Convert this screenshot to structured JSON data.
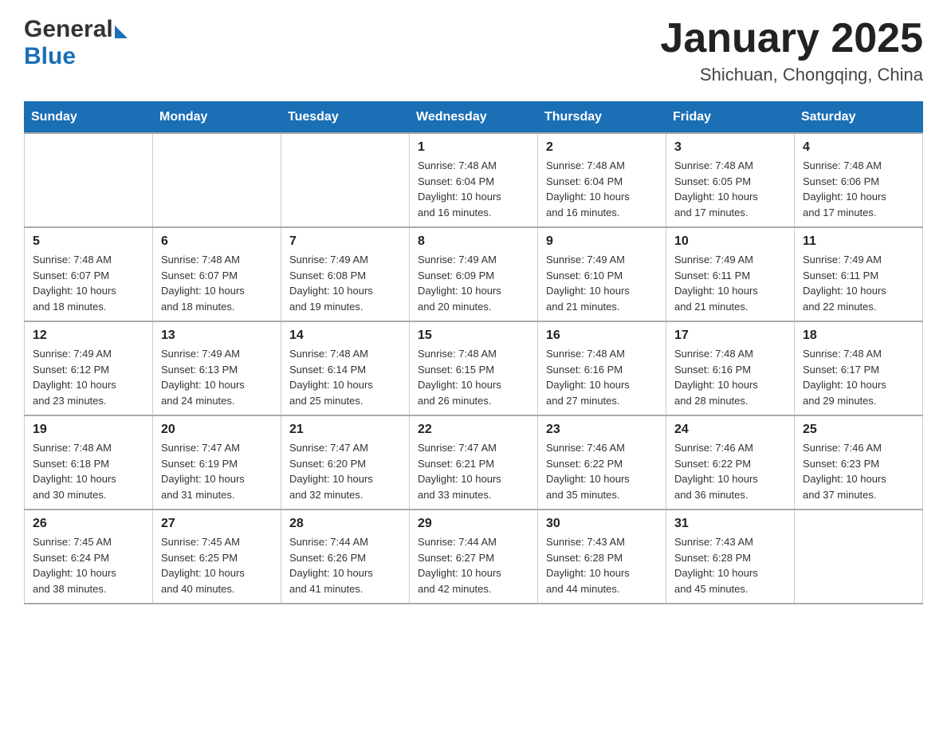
{
  "header": {
    "logo_general": "General",
    "logo_blue": "Blue",
    "month_title": "January 2025",
    "location": "Shichuan, Chongqing, China"
  },
  "weekdays": [
    "Sunday",
    "Monday",
    "Tuesday",
    "Wednesday",
    "Thursday",
    "Friday",
    "Saturday"
  ],
  "weeks": [
    [
      {
        "day": "",
        "info": ""
      },
      {
        "day": "",
        "info": ""
      },
      {
        "day": "",
        "info": ""
      },
      {
        "day": "1",
        "info": "Sunrise: 7:48 AM\nSunset: 6:04 PM\nDaylight: 10 hours\nand 16 minutes."
      },
      {
        "day": "2",
        "info": "Sunrise: 7:48 AM\nSunset: 6:04 PM\nDaylight: 10 hours\nand 16 minutes."
      },
      {
        "day": "3",
        "info": "Sunrise: 7:48 AM\nSunset: 6:05 PM\nDaylight: 10 hours\nand 17 minutes."
      },
      {
        "day": "4",
        "info": "Sunrise: 7:48 AM\nSunset: 6:06 PM\nDaylight: 10 hours\nand 17 minutes."
      }
    ],
    [
      {
        "day": "5",
        "info": "Sunrise: 7:48 AM\nSunset: 6:07 PM\nDaylight: 10 hours\nand 18 minutes."
      },
      {
        "day": "6",
        "info": "Sunrise: 7:48 AM\nSunset: 6:07 PM\nDaylight: 10 hours\nand 18 minutes."
      },
      {
        "day": "7",
        "info": "Sunrise: 7:49 AM\nSunset: 6:08 PM\nDaylight: 10 hours\nand 19 minutes."
      },
      {
        "day": "8",
        "info": "Sunrise: 7:49 AM\nSunset: 6:09 PM\nDaylight: 10 hours\nand 20 minutes."
      },
      {
        "day": "9",
        "info": "Sunrise: 7:49 AM\nSunset: 6:10 PM\nDaylight: 10 hours\nand 21 minutes."
      },
      {
        "day": "10",
        "info": "Sunrise: 7:49 AM\nSunset: 6:11 PM\nDaylight: 10 hours\nand 21 minutes."
      },
      {
        "day": "11",
        "info": "Sunrise: 7:49 AM\nSunset: 6:11 PM\nDaylight: 10 hours\nand 22 minutes."
      }
    ],
    [
      {
        "day": "12",
        "info": "Sunrise: 7:49 AM\nSunset: 6:12 PM\nDaylight: 10 hours\nand 23 minutes."
      },
      {
        "day": "13",
        "info": "Sunrise: 7:49 AM\nSunset: 6:13 PM\nDaylight: 10 hours\nand 24 minutes."
      },
      {
        "day": "14",
        "info": "Sunrise: 7:48 AM\nSunset: 6:14 PM\nDaylight: 10 hours\nand 25 minutes."
      },
      {
        "day": "15",
        "info": "Sunrise: 7:48 AM\nSunset: 6:15 PM\nDaylight: 10 hours\nand 26 minutes."
      },
      {
        "day": "16",
        "info": "Sunrise: 7:48 AM\nSunset: 6:16 PM\nDaylight: 10 hours\nand 27 minutes."
      },
      {
        "day": "17",
        "info": "Sunrise: 7:48 AM\nSunset: 6:16 PM\nDaylight: 10 hours\nand 28 minutes."
      },
      {
        "day": "18",
        "info": "Sunrise: 7:48 AM\nSunset: 6:17 PM\nDaylight: 10 hours\nand 29 minutes."
      }
    ],
    [
      {
        "day": "19",
        "info": "Sunrise: 7:48 AM\nSunset: 6:18 PM\nDaylight: 10 hours\nand 30 minutes."
      },
      {
        "day": "20",
        "info": "Sunrise: 7:47 AM\nSunset: 6:19 PM\nDaylight: 10 hours\nand 31 minutes."
      },
      {
        "day": "21",
        "info": "Sunrise: 7:47 AM\nSunset: 6:20 PM\nDaylight: 10 hours\nand 32 minutes."
      },
      {
        "day": "22",
        "info": "Sunrise: 7:47 AM\nSunset: 6:21 PM\nDaylight: 10 hours\nand 33 minutes."
      },
      {
        "day": "23",
        "info": "Sunrise: 7:46 AM\nSunset: 6:22 PM\nDaylight: 10 hours\nand 35 minutes."
      },
      {
        "day": "24",
        "info": "Sunrise: 7:46 AM\nSunset: 6:22 PM\nDaylight: 10 hours\nand 36 minutes."
      },
      {
        "day": "25",
        "info": "Sunrise: 7:46 AM\nSunset: 6:23 PM\nDaylight: 10 hours\nand 37 minutes."
      }
    ],
    [
      {
        "day": "26",
        "info": "Sunrise: 7:45 AM\nSunset: 6:24 PM\nDaylight: 10 hours\nand 38 minutes."
      },
      {
        "day": "27",
        "info": "Sunrise: 7:45 AM\nSunset: 6:25 PM\nDaylight: 10 hours\nand 40 minutes."
      },
      {
        "day": "28",
        "info": "Sunrise: 7:44 AM\nSunset: 6:26 PM\nDaylight: 10 hours\nand 41 minutes."
      },
      {
        "day": "29",
        "info": "Sunrise: 7:44 AM\nSunset: 6:27 PM\nDaylight: 10 hours\nand 42 minutes."
      },
      {
        "day": "30",
        "info": "Sunrise: 7:43 AM\nSunset: 6:28 PM\nDaylight: 10 hours\nand 44 minutes."
      },
      {
        "day": "31",
        "info": "Sunrise: 7:43 AM\nSunset: 6:28 PM\nDaylight: 10 hours\nand 45 minutes."
      },
      {
        "day": "",
        "info": ""
      }
    ]
  ]
}
